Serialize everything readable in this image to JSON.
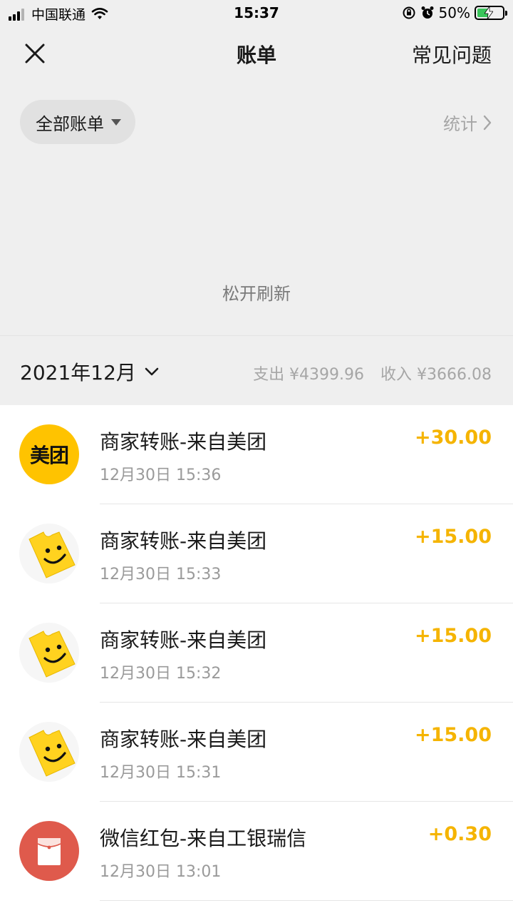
{
  "status_bar": {
    "carrier": "中国联通",
    "time": "15:37",
    "battery": "50%",
    "battery_level": 0.5
  },
  "nav": {
    "title": "账单",
    "faq_label": "常见问题"
  },
  "filter": {
    "label": "全部账单",
    "stats_label": "统计"
  },
  "refresh_hint": "松开刷新",
  "month": {
    "label": "2021年12月",
    "expense": "支出 ¥4399.96",
    "income": "收入 ¥3666.08"
  },
  "transactions": [
    {
      "title": "商家转账-来自美团",
      "time": "12月30日 15:36",
      "amount": "+30.00",
      "avatar_text": "美团"
    },
    {
      "title": "商家转账-来自美团",
      "time": "12月30日 15:33",
      "amount": "+15.00"
    },
    {
      "title": "商家转账-来自美团",
      "time": "12月30日 15:32",
      "amount": "+15.00"
    },
    {
      "title": "商家转账-来自美团",
      "time": "12月30日 15:31",
      "amount": "+15.00"
    },
    {
      "title": "微信红包-来自工银瑞信",
      "time": "12月30日 13:01",
      "amount": "+0.30"
    }
  ],
  "colors": {
    "income_amount": "#f5b400",
    "meituan_brand": "#ffc300",
    "hongbao": "#df5a4c",
    "header_bg": "#efefef"
  }
}
